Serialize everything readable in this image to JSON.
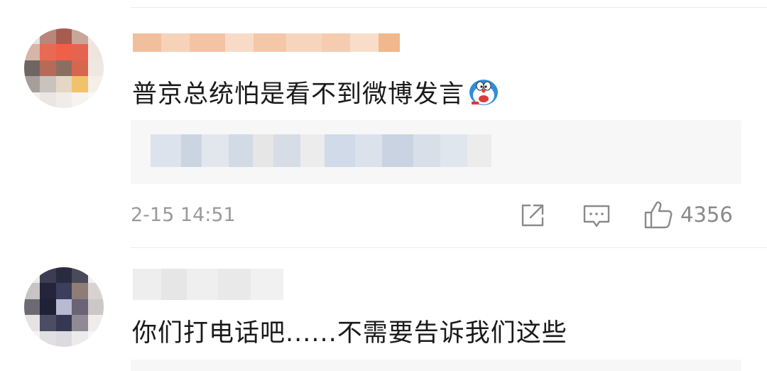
{
  "comments": [
    {
      "text": "普京总统怕是看不到微博发言",
      "emoji_icon": "doraemon-emoji-icon",
      "time": "2-15 14:51",
      "like_count": "4356"
    },
    {
      "text": "你们打电话吧......不需要告诉我们这些"
    }
  ],
  "icons": {
    "share": "share-icon",
    "comment": "comment-icon",
    "like": "thumbs-up-icon"
  },
  "colors": {
    "text": "#1a1a1a",
    "meta": "#9a9a9a",
    "quote_bg": "#f7f7f7",
    "username_blur": "#f4c7a8"
  }
}
